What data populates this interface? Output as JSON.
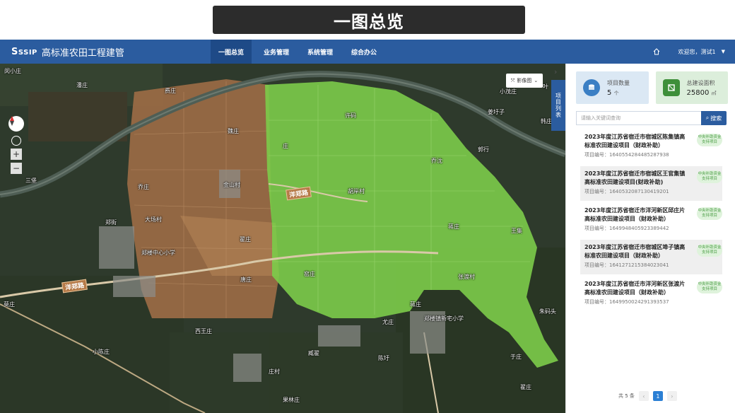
{
  "banner": {
    "title": "一图总览"
  },
  "app": {
    "logo_text": "SSIP",
    "title": "高标准农田工程建管",
    "nav": [
      {
        "label": "一图总览",
        "active": true
      },
      {
        "label": "业务管理",
        "active": false
      },
      {
        "label": "系统管理",
        "active": false
      },
      {
        "label": "综合办公",
        "active": false
      }
    ],
    "user_greeting": "欢迎您，测试1"
  },
  "map": {
    "layer_button": "影像图",
    "panel_tab": "项目列表",
    "places": [
      "闵小庄",
      "潘庄",
      "费庄",
      "魏庄",
      "叶",
      "小茂庄",
      "姜圩子",
      "许码",
      "韩庄",
      "庄",
      "郭行",
      "三堡",
      "乔庄",
      "乔沈",
      "金山村",
      "胡岸村",
      "郑街",
      "大场村",
      "翟庄",
      "蒋庄",
      "王集",
      "郑楼中心小学",
      "窑庄",
      "张渡村",
      "莫庄",
      "唐庄",
      "蒋庄",
      "郑楼镇新宅小学",
      "尤庄",
      "西王庄",
      "朱码头",
      "小陈庄",
      "臧翟",
      "于庄",
      "陈圩",
      "庄村",
      "翟庄",
      "果林庄"
    ],
    "roads": [
      "洋郑路",
      "洋郑路"
    ],
    "colors": {
      "green_plots": "#7ccc4a",
      "brown_plots": "#9b6b45"
    }
  },
  "stats": {
    "project_count_label": "项目数量",
    "project_count_value": "5",
    "project_count_unit": "个",
    "area_label": "总建设面积",
    "area_value": "25800",
    "area_unit": "㎡"
  },
  "search": {
    "placeholder": "请输入关键词查询",
    "button": "搜索"
  },
  "projects": [
    {
      "title": "2023年度江苏省宿迁市宿城区陈集镇高标准农田建设项目（财政补助）",
      "code_label": "项目编号：",
      "code": "1640554284485287938",
      "tag": "中央补助资金支持项目"
    },
    {
      "title": "2023年度江苏省宿迁市宿城区王官集镇高标准农田建设项目(财政补助)",
      "code_label": "项目编号：",
      "code": "1640532087130419201",
      "tag": "中央补助资金支持项目"
    },
    {
      "title": "2023年度江苏省宿迁市洋河新区邱庄片高标准农田建设项目（财政补助）",
      "code_label": "项目编号：",
      "code": "1649948405923389442",
      "tag": "中央补助资金支持项目"
    },
    {
      "title": "2023年度江苏省宿迁市宿城区埠子镇高标准农田建设项目（财政补助）",
      "code_label": "项目编号：",
      "code": "1641271215384023041",
      "tag": "中央补助资金支持项目"
    },
    {
      "title": "2023年度江苏省宿迁市洋河新区张渡片高标准农田建设项目（财政补助）",
      "code_label": "项目编号：",
      "code": "1649950024291393537",
      "tag": "中央补助资金支持项目"
    }
  ],
  "pager": {
    "total": "共 5 条",
    "current": "1",
    "prev": "‹",
    "next": "›"
  }
}
